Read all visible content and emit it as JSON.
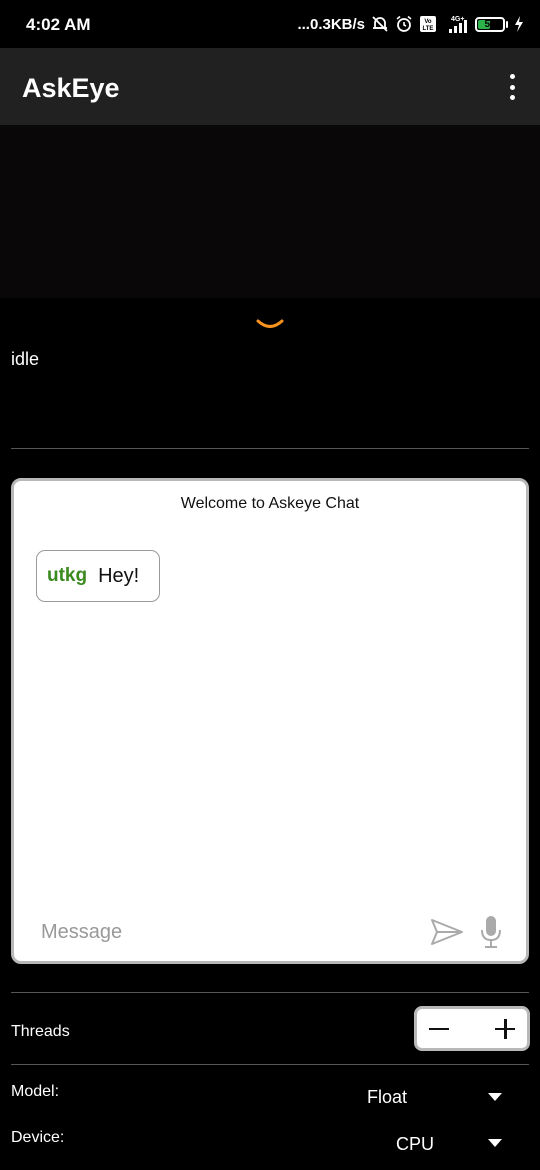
{
  "status_bar": {
    "time": "4:02 AM",
    "net_speed": "...0.3KB/s",
    "network_type": "4G+",
    "volte": "Vo LTE",
    "battery_level": "50",
    "battery_fraction": 0.5,
    "icons": [
      "mute-bell-icon",
      "alarm-icon",
      "volte-icon",
      "signal-icon",
      "battery-icon",
      "charging-icon"
    ]
  },
  "app_bar": {
    "title": "AskEye",
    "menu_icon": "overflow-menu-icon"
  },
  "detection": {
    "status": "idle",
    "expand_icon": "chevron-down-icon",
    "accent_color": "#f7931e"
  },
  "chat": {
    "welcome": "Welcome to Askeye Chat",
    "messages": [
      {
        "user": "utkg",
        "text": "Hey!"
      }
    ],
    "input_placeholder": "Message",
    "send_icon": "send-icon",
    "mic_icon": "mic-icon",
    "user_color": "#3a8a1f"
  },
  "settings": {
    "threads_label": "Threads",
    "model_label": "Model:",
    "model_value": "Float",
    "device_label": "Device:",
    "device_value": "CPU"
  }
}
